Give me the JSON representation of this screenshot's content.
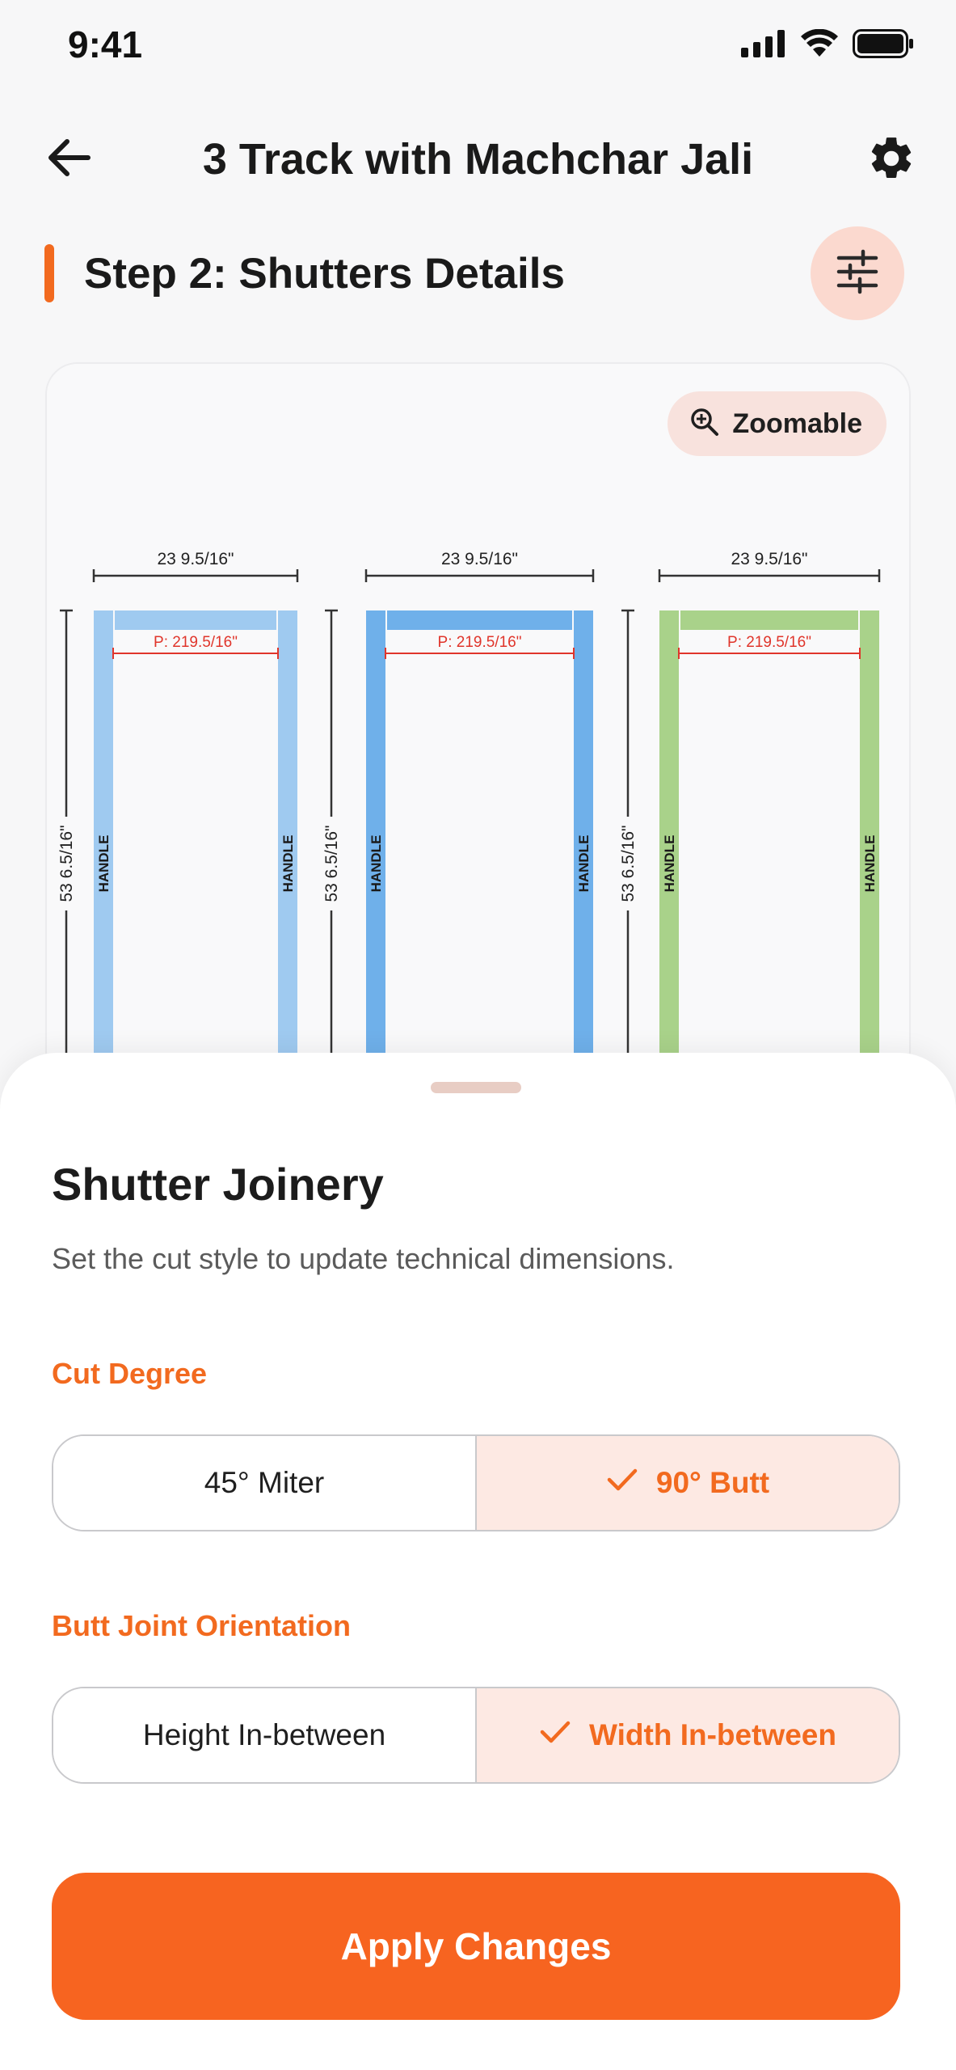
{
  "status_bar": {
    "time": "9:41",
    "icons": [
      "signal-icon",
      "wifi-icon",
      "battery-icon"
    ]
  },
  "header": {
    "title": "3 Track with Machchar Jali",
    "back_icon": "arrow-left-icon",
    "settings_icon": "gear-icon"
  },
  "step": {
    "title": "Step 2: Shutters Details",
    "filter_icon": "sliders-icon"
  },
  "diagram": {
    "zoom_label": "Zoomable",
    "zoom_icon": "zoom-in-icon",
    "shutters": [
      {
        "width_label": "23 9.5/16\"",
        "height_label": "53 6.5/16\"",
        "inner_label": "P: 219.5/16\"",
        "handle_left": "HANDLE",
        "handle_right": "HANDLE",
        "color": "#9fcaf0"
      },
      {
        "width_label": "23 9.5/16\"",
        "height_label": "53 6.5/16\"",
        "inner_label": "P: 219.5/16\"",
        "handle_left": "HANDLE",
        "handle_right": "HANDLE",
        "color": "#6fb0ea"
      },
      {
        "width_label": "23 9.5/16\"",
        "height_label": "53 6.5/16\"",
        "inner_label": "P: 219.5/16\"",
        "handle_left": "HANDLE",
        "handle_right": "HANDLE",
        "color": "#a9d28a"
      }
    ]
  },
  "sheet": {
    "title": "Shutter Joinery",
    "subtitle": "Set the cut style to update technical dimensions.",
    "cut_degree": {
      "label": "Cut Degree",
      "options": [
        {
          "label": "45° Miter",
          "selected": false
        },
        {
          "label": "90° Butt",
          "selected": true
        }
      ]
    },
    "orientation": {
      "label": "Butt Joint Orientation",
      "options": [
        {
          "label": "Height In-between",
          "selected": false
        },
        {
          "label": "Width In-between",
          "selected": true
        }
      ]
    },
    "apply_label": "Apply Changes"
  },
  "colors": {
    "accent": "#f26a1f",
    "accent_soft": "#fde9e3",
    "button": "#f76420",
    "dim_red": "#e0352b"
  }
}
